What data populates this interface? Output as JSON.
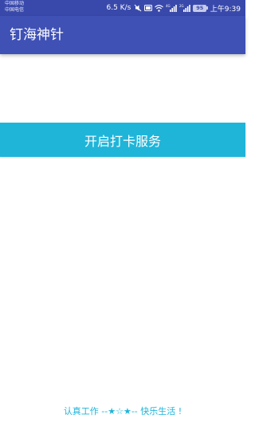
{
  "status_bar": {
    "carrier_1": "中国移动",
    "carrier_2": "中国电信",
    "net_speed": "6.5 K/s",
    "network_label_1": "4G",
    "network_label_2": "2G",
    "battery": "95",
    "time": "上午9:39"
  },
  "app_bar": {
    "title": "钉海神针"
  },
  "main": {
    "start_button_label": "开启打卡服务"
  },
  "footer": {
    "slogan": "认真工作 --★☆★-- 快乐生活 !"
  },
  "colors": {
    "status_bar": "#3949ab",
    "app_bar": "#3f51b5",
    "accent": "#1fb5d9",
    "background": "#ffffff"
  }
}
